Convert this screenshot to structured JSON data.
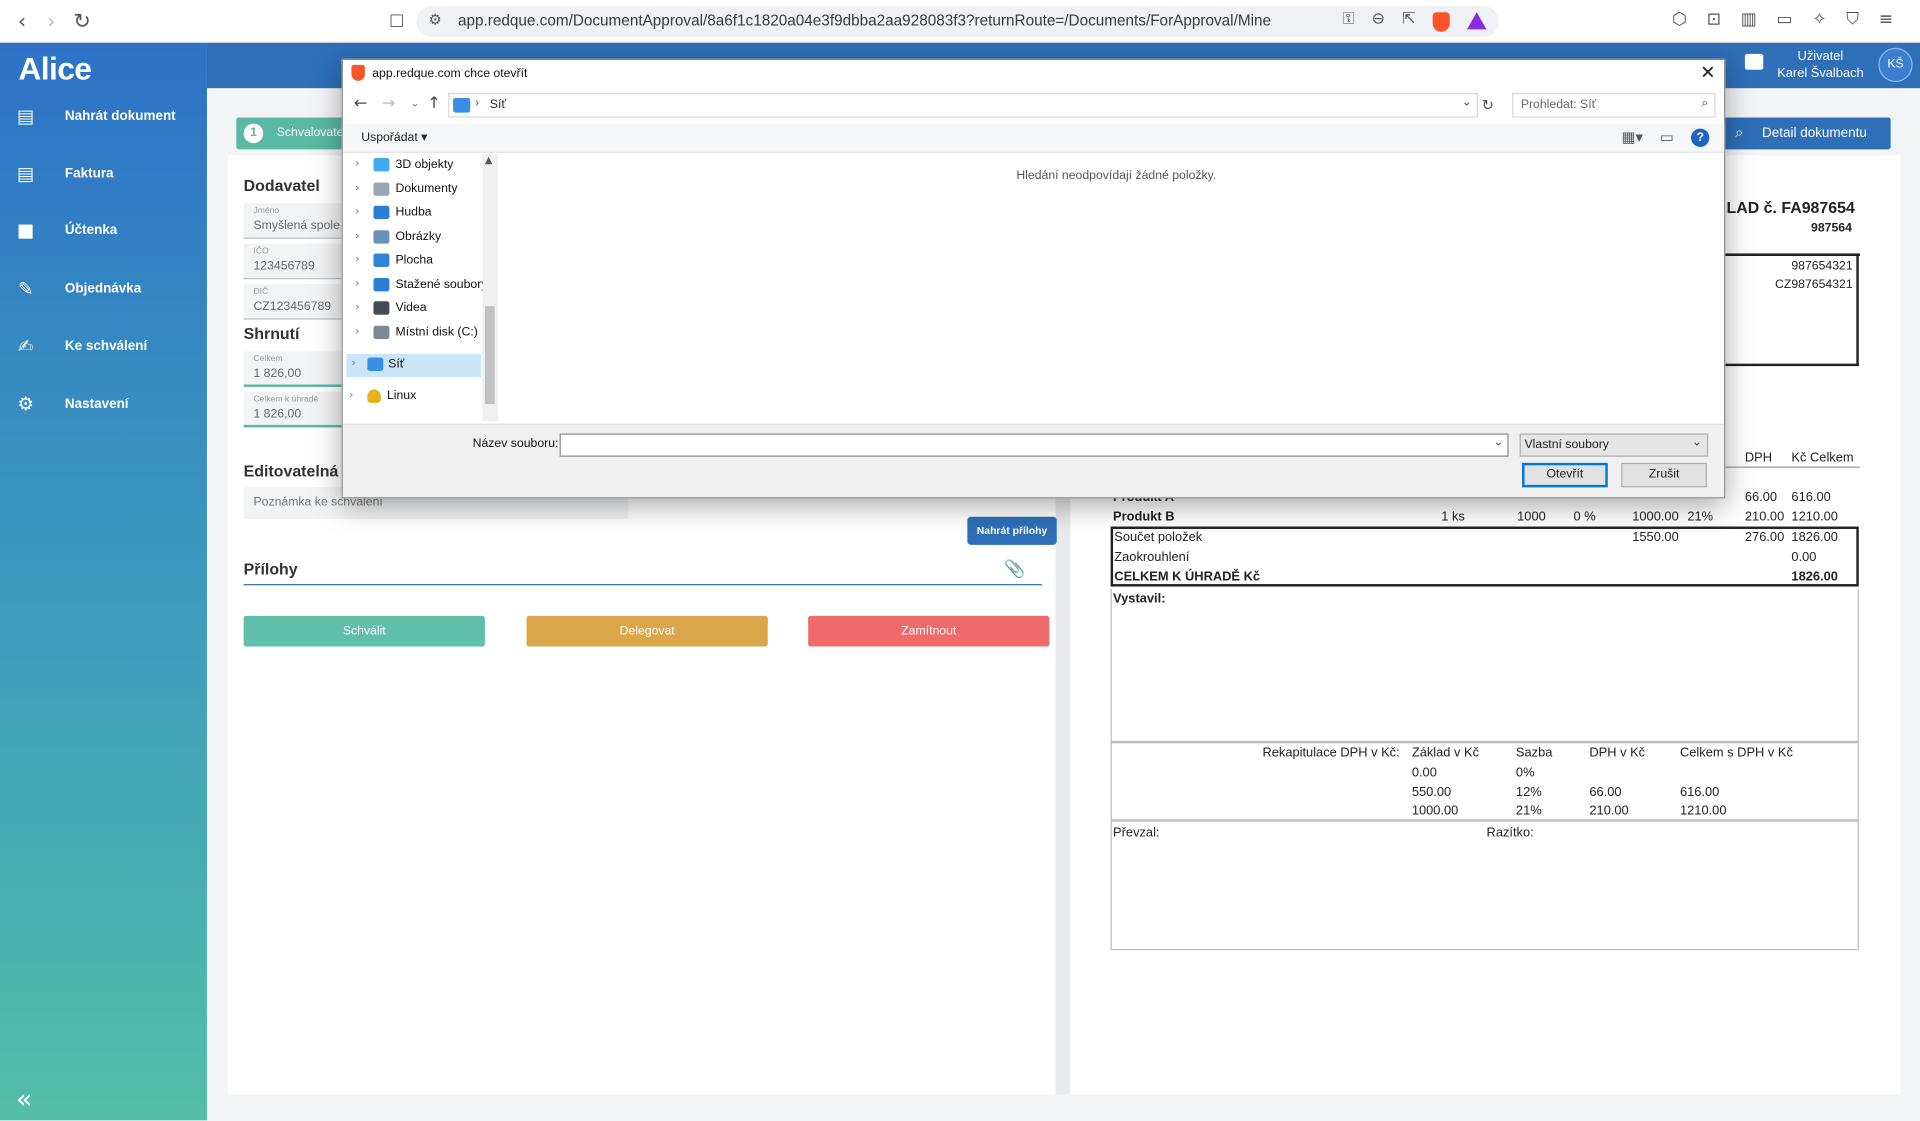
{
  "browser": {
    "url": "app.redque.com/DocumentApproval/8a6f1c1820a04e3f9dbba2aa928083f3?returnRoute=/Documents/ForApproval/Mine"
  },
  "app": {
    "logo": "Alice",
    "nav": [
      {
        "label": "Nahrát dokument",
        "icon": "upload-document-icon"
      },
      {
        "label": "Faktura",
        "icon": "invoice-icon"
      },
      {
        "label": "Účtenka",
        "icon": "receipt-icon"
      },
      {
        "label": "Objednávka",
        "icon": "order-icon"
      },
      {
        "label": "Ke schválení",
        "icon": "approval-icon"
      },
      {
        "label": "Nastavení",
        "icon": "gear-icon"
      }
    ],
    "user_title": "Uživatel",
    "user_name": "Karel Švalbach",
    "user_initials": "KŠ",
    "notification_count": "1"
  },
  "step": {
    "number": "1",
    "label": "Schvalovate"
  },
  "detail_button": "Detail dokumentu",
  "form": {
    "supplier_title": "Dodavatel",
    "name_label": "Jméno",
    "name_value": "Smyšlená spole",
    "ico_label": "IČO",
    "ico_value": "123456789",
    "dic_label": "DIČ",
    "dic_value": "CZ123456789",
    "summary_title": "Shrnutí",
    "total_label": "Celkem",
    "total_value": "1 826,00",
    "due_label": "Celkem k úhradě",
    "due_value": "1 826,00",
    "editable_title": "Editovatelná",
    "note_placeholder": "Poznámka ke schválení",
    "upload_attachments": "Nahrát přílohy",
    "attachments_title": "Přílohy",
    "approve": "Schválit",
    "delegate": "Delegovat",
    "reject": "Zamítnout"
  },
  "invoice": {
    "title": "LAD č. FA987654",
    "number": "987564",
    "ico": "987654321",
    "dic": "CZ987654321",
    "col_dph": "DPH",
    "col_total": "Kč Celkem",
    "row_a": {
      "name": "Produkt A",
      "dph": "66.00",
      "total": "616.00"
    },
    "row_b": {
      "name": "Produkt B",
      "qty": "1 ks",
      "price": "1000",
      "rate": "0 %",
      "base": "1000.00",
      "pct": "21%",
      "dph": "210.00",
      "total": "1210.00"
    },
    "sum_label": "Součet položek",
    "sum_base": "1550.00",
    "sum_dph": "276.00",
    "sum_total": "1826.00",
    "rounding_label": "Zaokrouhlení",
    "rounding_value": "0.00",
    "pay_label": "CELKEM K ÚHRADĚ Kč",
    "pay_value": "1826.00",
    "issued_by": "Vystavil:",
    "recap_label": "Rekapitulace DPH v Kč:",
    "recap_headers": [
      "Základ v Kč",
      "Sazba",
      "DPH v Kč",
      "Celkem s DPH v Kč"
    ],
    "recap_rows": [
      [
        "0.00",
        "0%",
        "",
        ""
      ],
      [
        "550.00",
        "12%",
        "66.00",
        "616.00"
      ],
      [
        "1000.00",
        "21%",
        "210.00",
        "1210.00"
      ]
    ],
    "received_by": "Převzal:",
    "stamp": "Razítko:"
  },
  "dialog": {
    "title": "app.redque.com chce otevřít",
    "location": "Síť",
    "search_placeholder": "Prohledat: Síť",
    "organize": "Uspořádat",
    "empty_message": "Hledání neodpovídají žádné položky.",
    "tree": [
      {
        "label": "3D objekty",
        "color": "#3fa9f5"
      },
      {
        "label": "Dokumenty",
        "color": "#9aa7b5"
      },
      {
        "label": "Hudba",
        "color": "#2a7fd4"
      },
      {
        "label": "Obrázky",
        "color": "#6b8fb7"
      },
      {
        "label": "Plocha",
        "color": "#2f84d8"
      },
      {
        "label": "Stažené soubory",
        "color": "#2a7fd4"
      },
      {
        "label": "Videa",
        "color": "#444b55"
      },
      {
        "label": "Místní disk (C:)",
        "color": "#7d8a96"
      },
      {
        "label": "Síť",
        "color": "#3a8ee6"
      },
      {
        "label": "Linux",
        "color": "#e8b21c"
      }
    ],
    "filename_label": "Název souboru:",
    "filename_value": "",
    "filetype": "Vlastní soubory",
    "open": "Otevřít",
    "cancel": "Zrušit"
  }
}
